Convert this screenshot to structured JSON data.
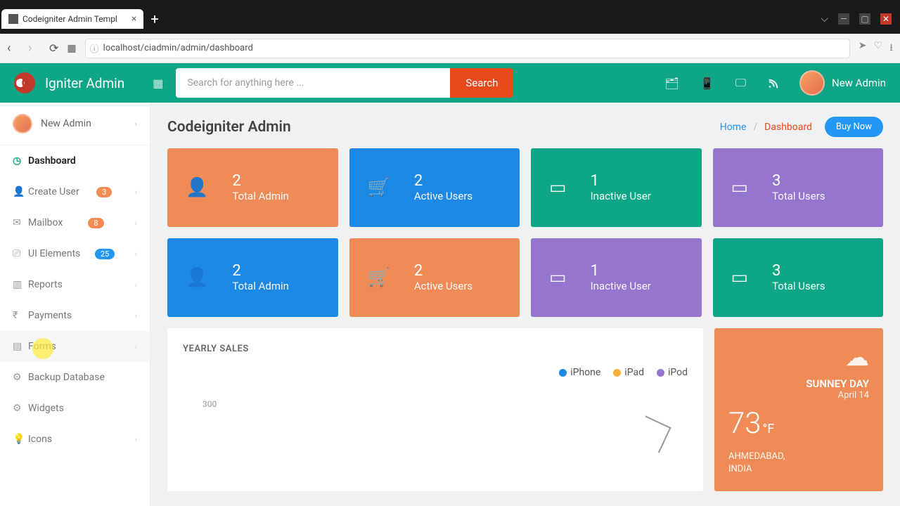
{
  "browser": {
    "tab_title": "Codeigniter Admin Templ",
    "url": "localhost/ciadmin/admin/dashboard"
  },
  "header": {
    "brand": "Igniter Admin",
    "search_placeholder": "Search for anything here ...",
    "search_btn": "Search",
    "user": "New Admin"
  },
  "sidebar": {
    "user": "New Admin",
    "items": [
      {
        "icon": "dashboard",
        "label": "Dashboard",
        "active": true
      },
      {
        "icon": "user",
        "label": "Create User",
        "badge": "3",
        "chev": true
      },
      {
        "icon": "mail",
        "label": "Mailbox",
        "badge": "8",
        "chev": true
      },
      {
        "icon": "sliders",
        "label": "UI Elements",
        "badge": "25",
        "badge_color": "blue",
        "chev": true
      },
      {
        "icon": "bar",
        "label": "Reports",
        "chev": true
      },
      {
        "icon": "rupee",
        "label": "Payments",
        "chev": true
      },
      {
        "icon": "clipboard",
        "label": "Forms",
        "chev": true,
        "hover": true,
        "cursor": true
      },
      {
        "icon": "gear",
        "label": "Backup Database"
      },
      {
        "icon": "gear",
        "label": "Widgets"
      },
      {
        "icon": "bulb",
        "label": "Icons",
        "chev": true
      }
    ]
  },
  "page": {
    "title": "Codeigniter Admin",
    "bc_home": "Home",
    "bc_current": "Dashboard",
    "buy": "Buy Now"
  },
  "cards": [
    {
      "num": "2",
      "label": "Total Admin",
      "color": "c-orange",
      "icon": "user"
    },
    {
      "num": "2",
      "label": "Active Users",
      "color": "c-blue",
      "icon": "cart"
    },
    {
      "num": "1",
      "label": "Inactive User",
      "color": "c-teal",
      "icon": "wallet"
    },
    {
      "num": "3",
      "label": "Total Users",
      "color": "c-purple",
      "icon": "wallet"
    },
    {
      "num": "2",
      "label": "Total Admin",
      "color": "c-blue",
      "icon": "user"
    },
    {
      "num": "2",
      "label": "Active Users",
      "color": "c-orange",
      "icon": "cart"
    },
    {
      "num": "1",
      "label": "Inactive User",
      "color": "c-purple",
      "icon": "wallet"
    },
    {
      "num": "3",
      "label": "Total Users",
      "color": "c-teal",
      "icon": "wallet"
    }
  ],
  "chart": {
    "title": "YEARLY SALES",
    "legend": [
      {
        "label": "iPhone",
        "color": "#1e88e5"
      },
      {
        "label": "iPad",
        "color": "#f5b041"
      },
      {
        "label": "iPod",
        "color": "#9575cd"
      }
    ],
    "ytick": "300"
  },
  "weather": {
    "cond": "SUNNEY DAY",
    "date": "April 14",
    "temp": "73",
    "unit": "°F",
    "city": "AHMEDABAD,",
    "country": "INDIA"
  },
  "chart_data": {
    "type": "line",
    "title": "YEARLY SALES",
    "ylim": [
      0,
      300
    ],
    "series": [
      {
        "name": "iPhone",
        "color": "#1e88e5"
      },
      {
        "name": "iPad",
        "color": "#f5b041"
      },
      {
        "name": "iPod",
        "color": "#9575cd"
      }
    ]
  }
}
